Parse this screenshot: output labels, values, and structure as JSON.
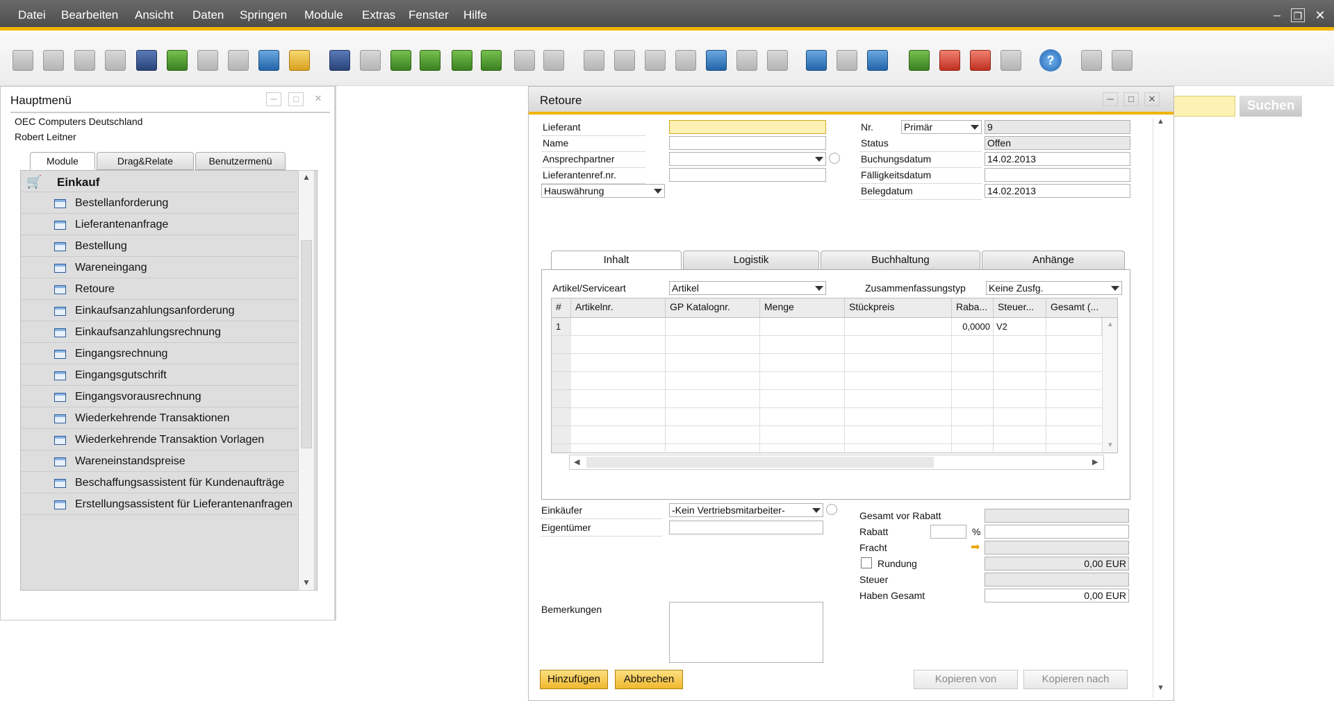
{
  "menubar": {
    "items": [
      "Datei",
      "Bearbeiten",
      "Ansicht",
      "Daten",
      "Springen",
      "Module",
      "Extras",
      "Fenster",
      "Hilfe"
    ]
  },
  "toolbar": {
    "help_icon": "?"
  },
  "search": {
    "button_label": "Suchen"
  },
  "main_menu": {
    "title": "Hauptmenü",
    "company": "OEC Computers Deutschland",
    "user": "Robert Leitner",
    "tabs": [
      "Module",
      "Drag&Relate",
      "Benutzermenü"
    ],
    "section": "Einkauf",
    "items": [
      "Bestellanforderung",
      "Lieferantenanfrage",
      "Bestellung",
      "Wareneingang",
      "Retoure",
      "Einkaufsanzahlungsanforderung",
      "Einkaufsanzahlungsrechnung",
      "Eingangsrechnung",
      "Eingangsgutschrift",
      "Eingangsvorausrechnung",
      "Wiederkehrende Transaktionen",
      "Wiederkehrende Transaktion Vorlagen",
      "Wareneinstandspreise",
      "Beschaffungsassistent für Kundenaufträge",
      "Erstellungsassistent für Lieferantenanfragen"
    ]
  },
  "retoure": {
    "title": "Retoure",
    "header_left": {
      "lieferant_label": "Lieferant",
      "name_label": "Name",
      "ansprechpartner_label": "Ansprechpartner",
      "lieferantenref_label": "Lieferantenref.nr.",
      "currency": "Hauswährung"
    },
    "header_right": {
      "nr_label": "Nr.",
      "series": "Primär",
      "nr_value": "9",
      "status_label": "Status",
      "status_value": "Offen",
      "buchungsdatum_label": "Buchungsdatum",
      "buchungsdatum_value": "14.02.2013",
      "faelligkeit_label": "Fälligkeitsdatum",
      "faelligkeit_value": "",
      "belegdatum_label": "Belegdatum",
      "belegdatum_value": "14.02.2013"
    },
    "tabs": [
      "Inhalt",
      "Logistik",
      "Buchhaltung",
      "Anhänge"
    ],
    "content": {
      "artikel_label": "Artikel/Serviceart",
      "artikel_value": "Artikel",
      "zusammenfassung_label": "Zusammenfassungstyp",
      "zusammenfassung_value": "Keine Zusfg.",
      "columns": [
        "#",
        "Artikelnr.",
        "GP Katalognr.",
        "Menge",
        "Stückpreis",
        "Raba...",
        "Steuer...",
        "Gesamt (..."
      ],
      "row1": {
        "num": "1",
        "rabatt": "0,0000",
        "steuer": "V2"
      }
    },
    "footer": {
      "einkaeufer_label": "Einkäufer",
      "einkaeufer_value": "-Kein Vertriebsmitarbeiter-",
      "eigentuemer_label": "Eigentümer",
      "bemerkungen_label": "Bemerkungen",
      "gesamt_vor_rabatt_label": "Gesamt vor Rabatt",
      "rabatt_label": "Rabatt",
      "percent": "%",
      "fracht_label": "Fracht",
      "rundung_label": "Rundung",
      "rundung_value": "0,00 EUR",
      "steuer_label": "Steuer",
      "haben_gesamt_label": "Haben Gesamt",
      "haben_gesamt_value": "0,00 EUR"
    },
    "buttons": {
      "add": "Hinzufügen",
      "cancel": "Abbrechen",
      "copy_from": "Kopieren von",
      "copy_to": "Kopieren nach"
    }
  }
}
